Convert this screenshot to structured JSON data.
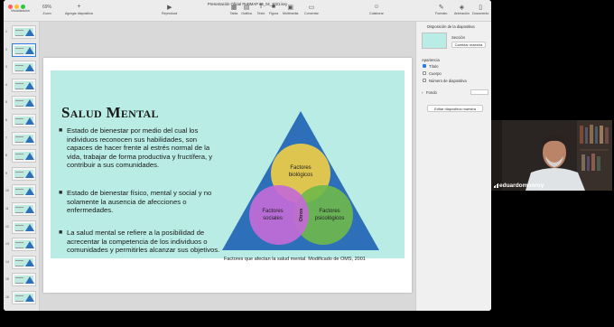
{
  "window": {
    "title": "Presentación Oficial PUBMAP 26_04_2021.key"
  },
  "toolbar": {
    "items": [
      {
        "label": "Visualización",
        "icon": "sidebar-icon"
      },
      {
        "label": "Zoom",
        "value": "69%",
        "icon": "zoom-icon"
      },
      {
        "label": "Agregar diapositiva",
        "icon": "plus-icon"
      },
      {
        "label": "Reproducir",
        "icon": "play-icon"
      },
      {
        "label": "Tabla",
        "icon": "table-icon"
      },
      {
        "label": "Gráfica",
        "icon": "chart-icon"
      },
      {
        "label": "Texto",
        "icon": "text-icon"
      },
      {
        "label": "Figura",
        "icon": "shape-icon"
      },
      {
        "label": "Multimedia",
        "icon": "media-icon"
      },
      {
        "label": "Comentar",
        "icon": "comment-icon"
      },
      {
        "label": "Colaborar",
        "icon": "collaborate-icon"
      },
      {
        "label": "Formato",
        "icon": "format-icon"
      },
      {
        "label": "Animación",
        "icon": "animate-icon"
      },
      {
        "label": "Documento",
        "icon": "document-icon"
      }
    ]
  },
  "navigator": {
    "slide_numbers": [
      "1",
      "2",
      "3",
      "4",
      "5",
      "6",
      "7",
      "8",
      "9",
      "10",
      "11",
      "12",
      "13",
      "14",
      "15",
      "16"
    ]
  },
  "slide": {
    "title": "Salud Mental",
    "bullets": [
      "Estado de bienestar por medio del cual los individuos reconocen sus habilidades, son capaces de hacer frente al estrés normal de la vida, trabajar de forma productiva y fructífera, y contribuir a sus comunidades.",
      "Estado de bienestar físico, mental y social y no solamente la ausencia de afecciones o enfermedades.",
      "La salud mental se refiere a la posibilidad de acrecentar la competencia de los individuos o comunidades y permitirles alcanzar sus objetivos."
    ],
    "diagram": {
      "circle_top": [
        "Factores",
        "biológicos"
      ],
      "circle_left": [
        "Factores",
        "sociales"
      ],
      "circle_right": [
        "Factores",
        "psicológicos"
      ],
      "center": "Otros",
      "colors": {
        "triangle": "#2d6fb8",
        "top": "#e8c94a",
        "left": "#c36ad6",
        "right": "#6fb84a"
      }
    },
    "caption": "Factores que afectan la salud mental. Modificado de OMS, 2001",
    "panel_color": "#b8ece4"
  },
  "inspector": {
    "header": "Disposición de la diapositiva",
    "section_label": "Sección",
    "change_master_button": "Cambiar maestra",
    "appearance_label": "Apariencia",
    "options": [
      {
        "label": "Título",
        "checked": true
      },
      {
        "label": "Cuerpo",
        "checked": false
      },
      {
        "label": "Número de diapositiva",
        "checked": false
      }
    ],
    "background_label": "Fondo",
    "edit_master_button": "Editar diapositiva maestra"
  },
  "video": {
    "participant_name": "eduardomonroy"
  }
}
